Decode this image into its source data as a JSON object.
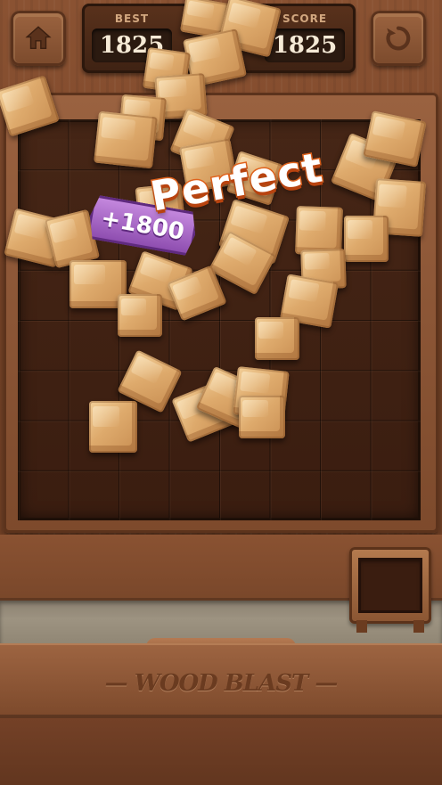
{
  "game_title": "WOOD BLAST",
  "scoreboard": {
    "best_label": "BEST",
    "best_value": "1825",
    "score_label": "SCORE",
    "score_value": "1825"
  },
  "buttons": {
    "home_icon": "home-icon",
    "restart_icon": "restart-icon"
  },
  "board": {
    "rows": 8,
    "cols": 8
  },
  "popups": {
    "praise": "Perfect",
    "bonus": "+1800"
  },
  "colors": {
    "wood_frame": "#8a5232",
    "board_dark": "#3c1f12",
    "praise_stroke": "#e0631d",
    "bonus_badge": "#a85fc8",
    "cube_light": "#f3cf98"
  }
}
